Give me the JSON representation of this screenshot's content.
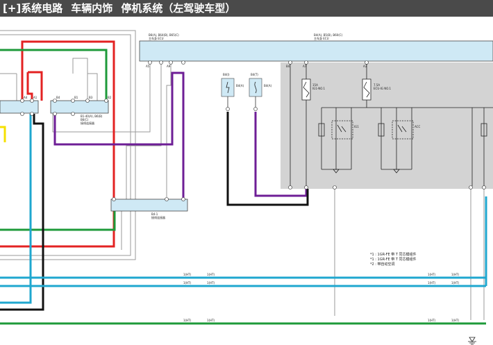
{
  "header": {
    "expand_label": "[+]",
    "breadcrumb": [
      "系统电路",
      "车辆内饰",
      "停机系统（左驾驶车型）"
    ]
  },
  "diagram": {
    "ecu_left": {
      "name": "B6(A), B64(B), B65(C)",
      "sub": "主车身 ECU"
    },
    "ecu_right": {
      "name": "B4(A), B5(B), B60(C)",
      "sub": "主车身 ECU"
    },
    "junction_a": {
      "code": "B1-40(A), B6(B)",
      "name": "B6(C)",
      "sub": "接线连接器"
    },
    "junction_b": {
      "code": "B4-1",
      "name": "接线连接器"
    },
    "sensor_1": {
      "code": "B4(I)",
      "name": "B4(A)"
    },
    "sensor_2": {
      "code": "B4(T)",
      "name": "B4(A)"
    },
    "fuses": [
      {
        "label": "15A",
        "name": "IG1-NO.1"
      },
      {
        "label": "7.5A",
        "name": "ECU-IG NO.1"
      }
    ],
    "relays": [
      "IG1",
      "ACC"
    ],
    "notes": [
      "*1 : 1GR-FE 带 T 同芯模组件",
      "*1 : 1GR-FE 带 T 同芯模组件",
      "*2 : 带自动空调"
    ],
    "bus_labels": {
      "cyan_top": [
        "1(HT)",
        "1(HT)",
        "1(HT)",
        "1(HT)"
      ],
      "cyan_bot": [
        "1(HT)",
        "1(HT)",
        "1(HT)",
        "1(HT)"
      ],
      "green": [
        "1(HT)",
        "1(HT)",
        "1(HT)",
        "1(HT)"
      ]
    },
    "pins_left": [
      "A4",
      "A1",
      "A3",
      "A2",
      "B4",
      "B1",
      "B3",
      "B2"
    ],
    "pins_ecu_right": [
      "B4",
      "A7",
      "A3"
    ],
    "pins_ecu_left": [
      "A5",
      "A9"
    ],
    "colors": {
      "red": "#e32222",
      "green": "#1e9a3a",
      "purple": "#6e1e96",
      "black": "#111111",
      "cyan": "#1fa7cf",
      "gray_wire": "#9a9a9a",
      "yellow": "#f5e000",
      "panel": "#d3d3d3",
      "box": "#cfe9f5"
    }
  }
}
